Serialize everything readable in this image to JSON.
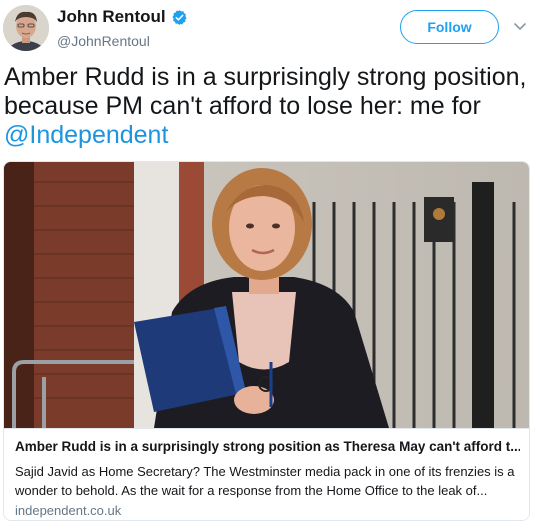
{
  "author": {
    "display_name": "John Rentoul",
    "handle": "@JohnRentoul",
    "verified": true
  },
  "actions": {
    "follow_label": "Follow"
  },
  "tweet": {
    "text_before": "Amber Rudd is in a surprisingly strong position, because PM can't afford to lose her: me for ",
    "mention": "@Independent"
  },
  "card": {
    "title": "Amber Rudd is in a surprisingly strong position as Theresa May can't afford t...",
    "description": "Sajid Javid as Home Secretary? The Westminster media pack in one of its frenzies is a wonder to behold. As the wait for a response from the Home Office to the leak of...",
    "domain": "independent.co.uk"
  },
  "colors": {
    "accent": "#1da1f2",
    "mention": "#1b95e0",
    "secondary_text": "#657786"
  },
  "icons": {
    "verified": "verified-badge-icon",
    "menu": "chevron-down-icon"
  }
}
